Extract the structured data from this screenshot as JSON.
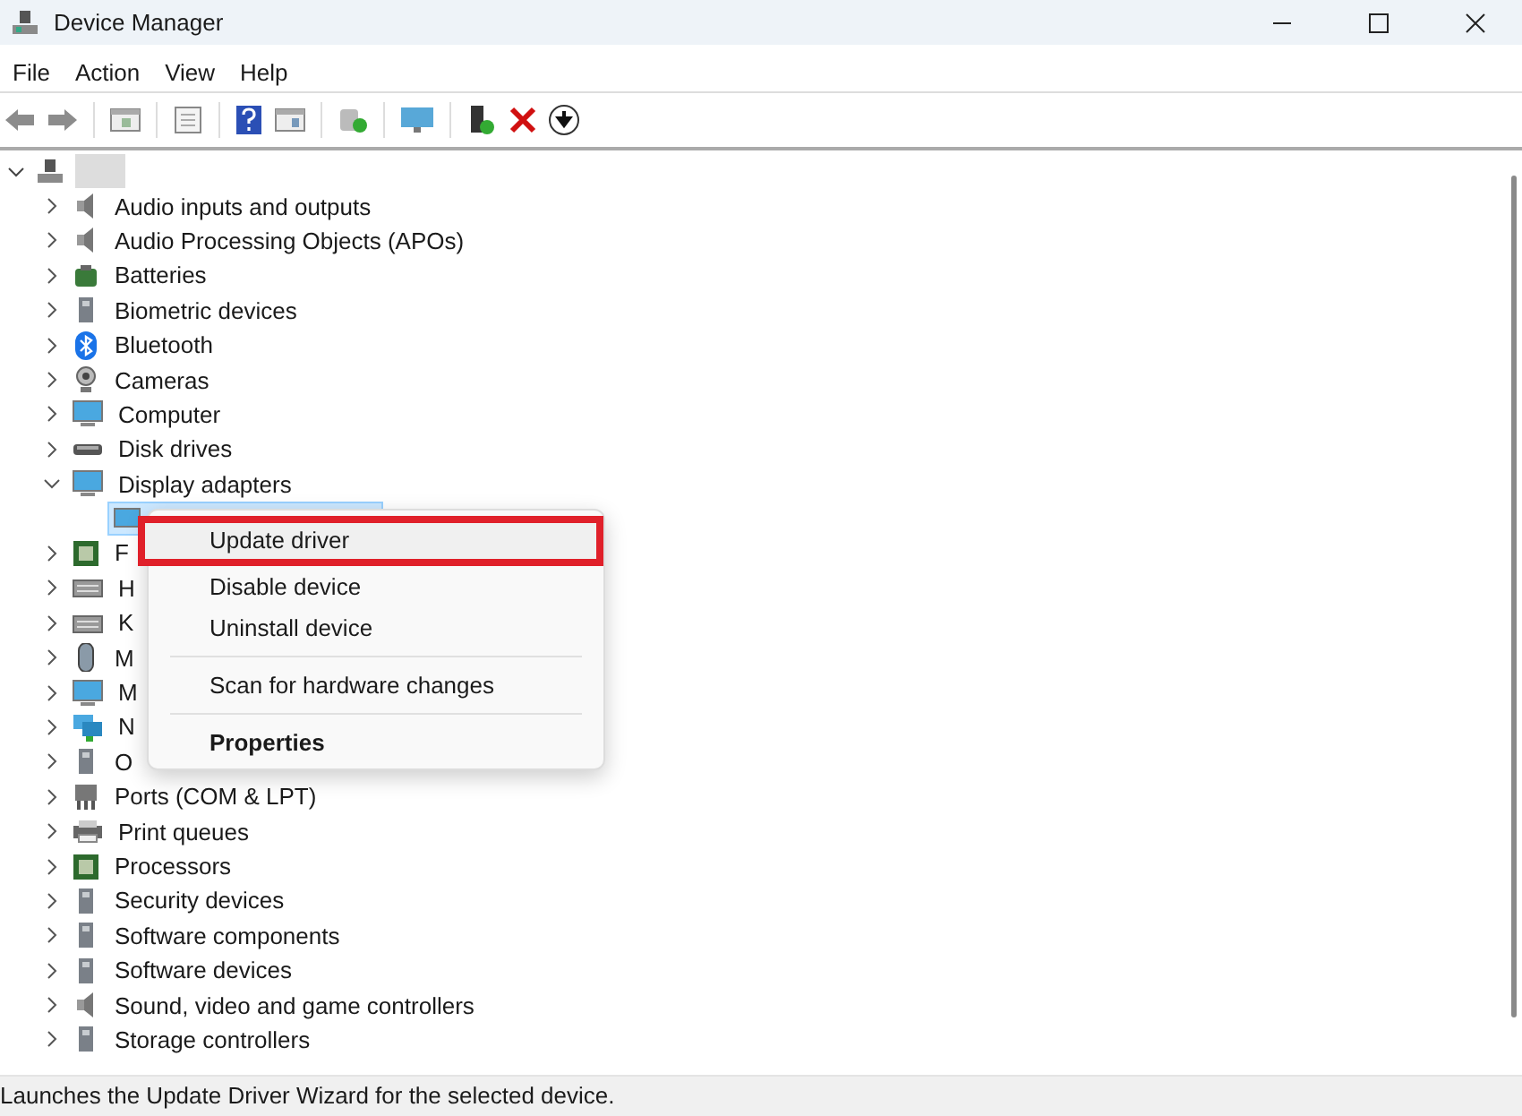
{
  "window": {
    "title": "Device Manager"
  },
  "menu_bar": [
    "File",
    "Action",
    "View",
    "Help"
  ],
  "tree": {
    "expanded": true,
    "children": [
      {
        "label": "Audio inputs and outputs",
        "expanded": false
      },
      {
        "label": "Audio Processing Objects (APOs)",
        "expanded": false
      },
      {
        "label": "Batteries",
        "expanded": false
      },
      {
        "label": "Biometric devices",
        "expanded": false
      },
      {
        "label": "Bluetooth",
        "expanded": false
      },
      {
        "label": "Cameras",
        "expanded": false
      },
      {
        "label": "Computer",
        "expanded": false
      },
      {
        "label": "Disk drives",
        "expanded": false
      },
      {
        "label": "Display adapters",
        "expanded": true,
        "children": [
          {
            "selected": true
          }
        ]
      },
      {
        "label": "F",
        "expanded": false
      },
      {
        "label": "H",
        "expanded": false
      },
      {
        "label": "K",
        "expanded": false
      },
      {
        "label": "M",
        "expanded": false
      },
      {
        "label": "M",
        "expanded": false
      },
      {
        "label": "N",
        "expanded": false
      },
      {
        "label": "O",
        "expanded": false
      },
      {
        "label": "Ports (COM & LPT)",
        "expanded": false
      },
      {
        "label": "Print queues",
        "expanded": false
      },
      {
        "label": "Processors",
        "expanded": false
      },
      {
        "label": "Security devices",
        "expanded": false
      },
      {
        "label": "Software components",
        "expanded": false
      },
      {
        "label": "Software devices",
        "expanded": false
      },
      {
        "label": "Sound, video and game controllers",
        "expanded": false
      },
      {
        "label": "Storage controllers",
        "expanded": false
      }
    ]
  },
  "context_menu": [
    {
      "label": "Update driver",
      "selected": true,
      "bold": false,
      "separator_before": false
    },
    {
      "label": "Disable device",
      "selected": false,
      "bold": false,
      "separator_before": false
    },
    {
      "label": "Uninstall device",
      "selected": false,
      "bold": false,
      "separator_before": false
    },
    {
      "label": "Scan for hardware changes",
      "selected": false,
      "bold": false,
      "separator_before": true
    },
    {
      "label": "Properties",
      "selected": false,
      "bold": true,
      "separator_before": true
    }
  ],
  "status_bar": "Launches the Update Driver Wizard for the selected device."
}
